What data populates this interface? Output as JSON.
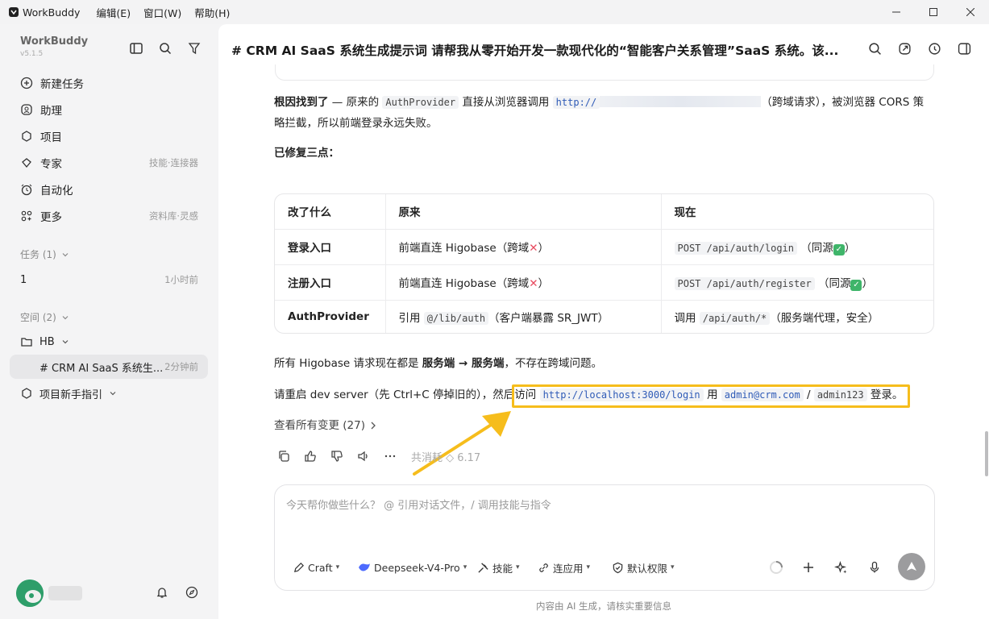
{
  "titlebar": {
    "app_name": "WorkBuddy",
    "menus": [
      "编辑(E)",
      "窗口(W)",
      "帮助(H)"
    ]
  },
  "sidebar": {
    "brand": "WorkBuddy",
    "version": "v5.1.5",
    "nav": [
      {
        "label": "新建任务",
        "hint": "",
        "icon": "plus-circle-icon"
      },
      {
        "label": "助理",
        "hint": "",
        "icon": "assistant-icon"
      },
      {
        "label": "项目",
        "hint": "",
        "icon": "project-icon"
      },
      {
        "label": "专家",
        "hint": "技能·连接器",
        "icon": "expert-icon"
      },
      {
        "label": "自动化",
        "hint": "",
        "icon": "alarm-icon"
      },
      {
        "label": "更多",
        "hint": "资料库·灵感",
        "icon": "grid-icon"
      }
    ],
    "tasks_section": "任务 (1)",
    "tasks": [
      {
        "label": "1",
        "time": "1小时前"
      }
    ],
    "spaces_section": "空间 (2)",
    "space_folder": "HB",
    "space_item": {
      "label": "# CRM AI SaaS 系统生...",
      "time": "2分钟前"
    },
    "guide": "项目新手指引"
  },
  "main": {
    "title": "# CRM AI SaaS 系统生成提示词 请帮我从零开始开发一款现代化的“智能客户关系管理”SaaS 系统。该...",
    "para1": {
      "strong": "根因找到了",
      "t1": " — 原来的 ",
      "code1": "AuthProvider",
      "t2": " 直接从浏览器调用 ",
      "code2": "http://",
      "t3": "（跨域请求），被浏览器 CORS 策",
      "line2": "略拦截，所以前端登录永远失败。"
    },
    "fixed_heading": "已修复三点：",
    "table": {
      "headers": [
        "改了什么",
        "原来",
        "现在"
      ],
      "rows": [
        {
          "what": "登录入口",
          "before": "前端直连 Higobase（跨域",
          "before_code": "",
          "before_tail": "",
          "now_code": "POST /api/auth/login",
          "now_tail": "（同源",
          "bad": "✕",
          "ok": "✓"
        },
        {
          "what": "注册入口",
          "before": "前端直连 Higobase（跨域",
          "before_code": "",
          "before_tail": "",
          "now_code": "POST /api/auth/register",
          "now_tail": "（同源",
          "bad": "✕",
          "ok": "✓"
        },
        {
          "what": "AuthProvider",
          "before": "引用 ",
          "before_code": "@/lib/auth",
          "before_tail": "（客户端暴露 SR_JWT）",
          "now_pre": "调用 ",
          "now_code": "/api/auth/*",
          "now_tail": "（服务端代理，安全）"
        }
      ]
    },
    "para2": {
      "t1": "所有 Higobase 请求现在都是 ",
      "s1": "服务端",
      "arrow": " → ",
      "s2": "服务端",
      "t2": "，不存在跨域问题。"
    },
    "para3": {
      "t1": "请重启 dev server（先 Ctrl+C 停掉旧的），然后访问 ",
      "link": "http://localhost:3000/login",
      "t2": " 用 ",
      "email": "admin@crm.com",
      "t3": " / ",
      "pwd": "admin123",
      "t4": " 登录。"
    },
    "changes_link": "查看所有变更 (27)",
    "consume": "共消耗 ◇ 6.17",
    "composer": {
      "placeholder": "今天帮你做些什么？ @ 引用对话文件，/ 调用技能与指令",
      "tools": [
        "Craft",
        "Deepseek-V4-Pro",
        "技能",
        "连应用",
        "默认权限"
      ]
    },
    "footer": "内容由 AI 生成，请核实重要信息"
  }
}
